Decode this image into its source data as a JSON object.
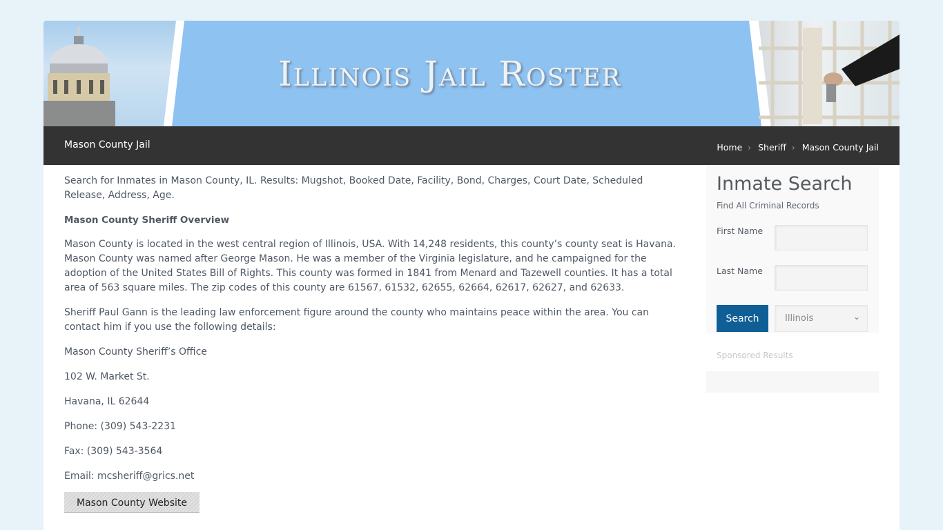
{
  "banner": {
    "title": "Illinois Jail Roster",
    "left_image": "illinois-capitol-dome-image",
    "right_image": "jail-cell-door-keys-image",
    "background_color": "#8ec2f1"
  },
  "titlebar": {
    "page_title": "Mason County Jail",
    "breadcrumb": [
      {
        "label": "Home"
      },
      {
        "label": "Sheriff"
      },
      {
        "label": "Mason County Jail"
      }
    ],
    "separator_icon": "chevron-right-icon"
  },
  "main": {
    "intro": "Search for Inmates in Mason County, IL. Results: Mugshot, Booked Date, Facility, Bond, Charges, Court Date, Scheduled Release, Address, Age.",
    "overview_heading": "Mason County Sheriff Overview",
    "overview_paragraph": "Mason County is located in the west central region of Illinois, USA. With 14,248 residents, this county’s county seat is Havana. Mason County was named after George Mason. He was a member of the Virginia legislature, and he campaigned for the adoption of the United States Bill of Rights. This county was formed in 1841 from Menard and Tazewell counties. It has a total area of 563 square miles. The zip codes of this county are 61567, 61532, 62655, 62664, 62617, 62627, and 62633.",
    "sheriff_paragraph": "Sheriff Paul Gann is the leading law enforcement figure around the county who maintains peace within the area. You can contact him if you use the following details:",
    "contact": {
      "office": "Mason County Sheriff’s Office",
      "street": "102 W. Market St.",
      "city": "Havana, IL 62644",
      "phone": "Phone: (309) 543-2231",
      "fax": "Fax: (309) 543-3564",
      "email": "Email: mcsheriff@grics.net"
    },
    "website_button": "Mason County Website"
  },
  "sidebar": {
    "title": "Inmate Search",
    "subtitle": "Find All Criminal Records",
    "first_name_label": "First Name",
    "first_name_value": "",
    "last_name_label": "Last Name",
    "last_name_value": "",
    "search_button": "Search",
    "state_select": {
      "selected": "Illinois"
    },
    "sponsored_label": "Sponsored Results",
    "accent_color": "#0f5e96"
  }
}
